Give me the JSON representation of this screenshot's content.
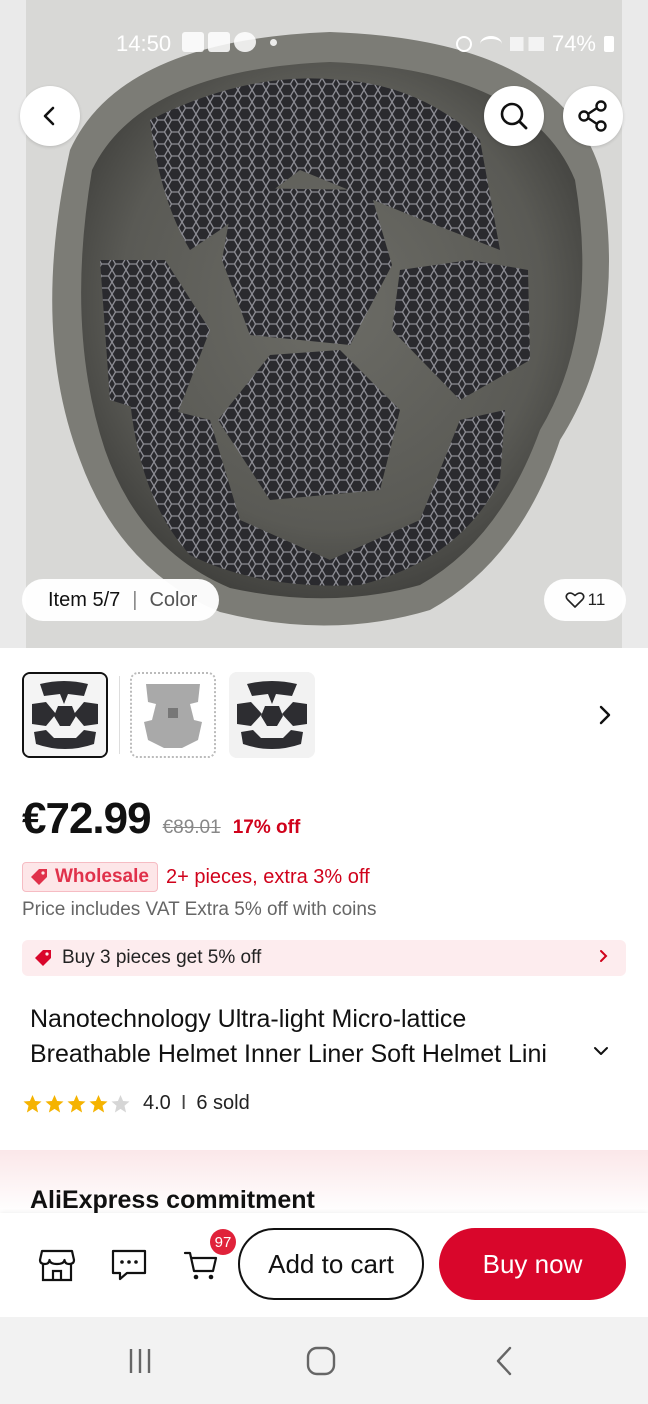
{
  "status_bar": {
    "time": "14:50",
    "battery": "74%"
  },
  "gallery": {
    "item_label": "Item 5/7",
    "separator": "|",
    "variant_label": "Color",
    "favorites_count": "11",
    "thumbnails": [
      "helmet-liner-black",
      "helmet-liner-grey",
      "helmet-liner-black-alt"
    ]
  },
  "price": {
    "current": "€72.99",
    "original": "€89.01",
    "discount": "17% off"
  },
  "wholesale": {
    "badge": "Wholesale",
    "text": "2+ pieces, extra 3% off"
  },
  "vat_line": "Price includes VAT Extra 5% off with coins",
  "promo": {
    "text": "Buy 3 pieces get 5% off"
  },
  "product": {
    "title_line1": "Nanotechnology Ultra-light Micro-lattice",
    "title_line2": "Breathable Helmet Inner Liner Soft Helmet Lini",
    "rating": "4.0",
    "rating_stars": 4,
    "rating_separator": "I",
    "sold": "6 sold"
  },
  "commitment": {
    "title": "AliExpress commitment"
  },
  "bottom_bar": {
    "cart_count": "97",
    "add_to_cart": "Add to cart",
    "buy_now": "Buy now"
  },
  "colors": {
    "accent_red": "#d9062b",
    "discount_red": "#d0021b",
    "star_gold": "#f5b301"
  }
}
